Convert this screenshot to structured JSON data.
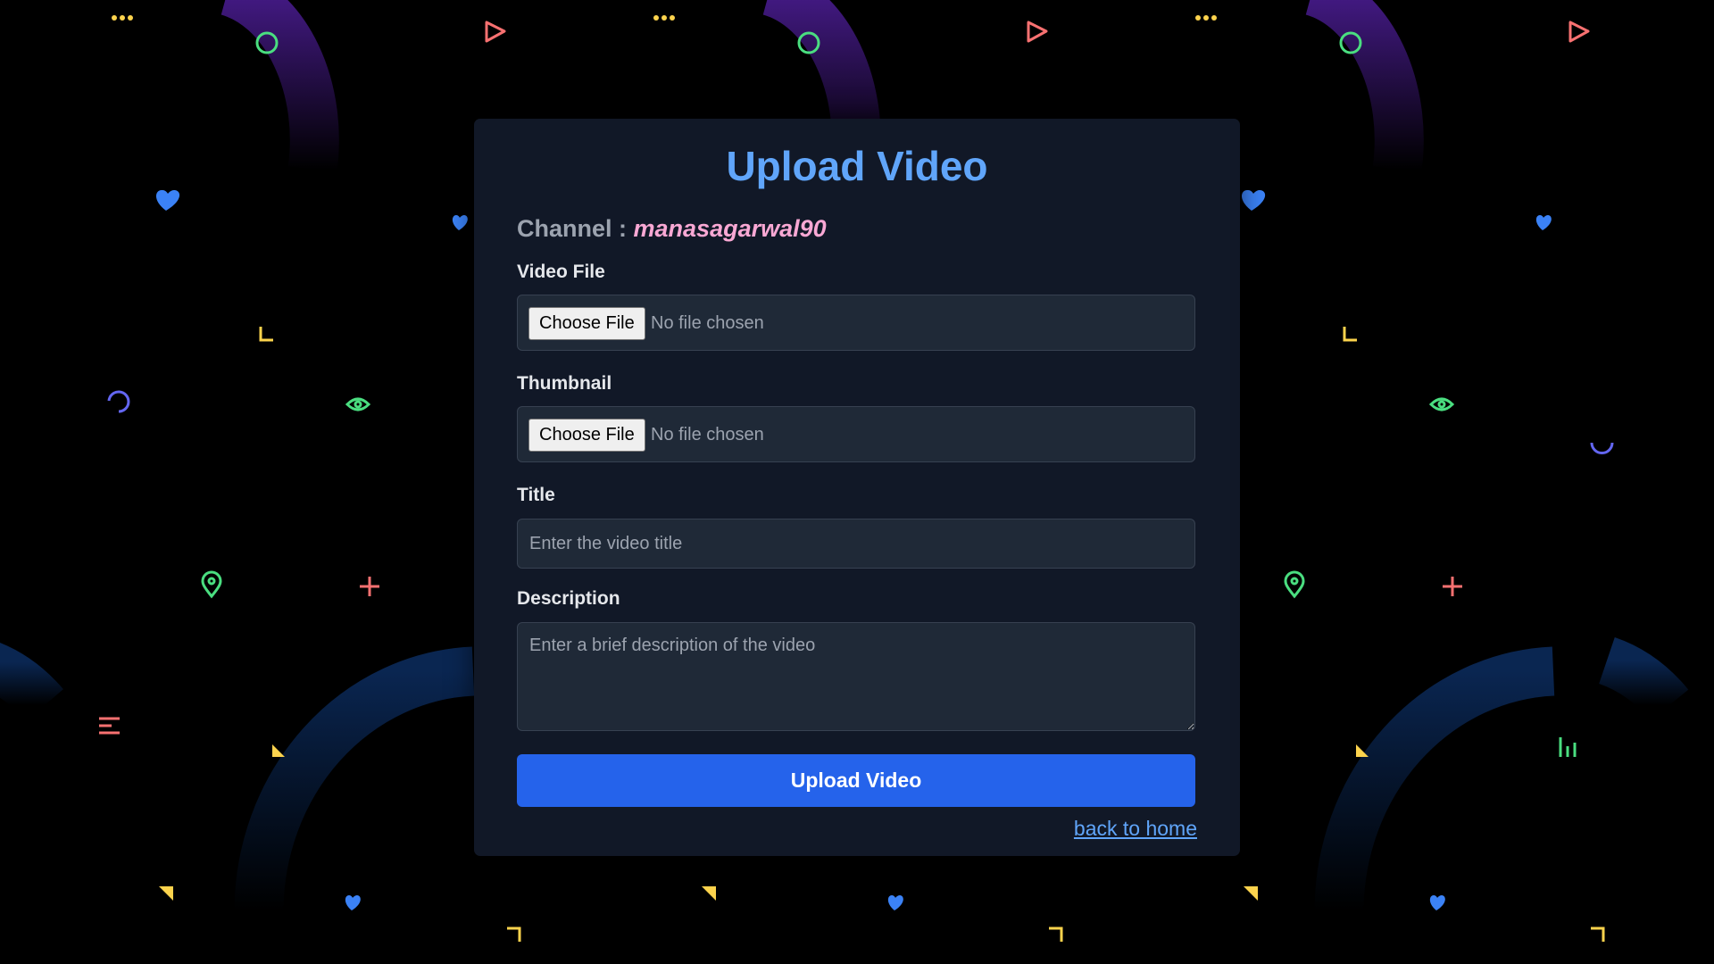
{
  "page": {
    "title": "Upload Video",
    "channel_label": "Channel : ",
    "channel_name": "manasagarwal90"
  },
  "form": {
    "video_file": {
      "label": "Video File",
      "button_label": "Choose File",
      "status": "No file chosen"
    },
    "thumbnail": {
      "label": "Thumbnail",
      "button_label": "Choose File",
      "status": "No file chosen"
    },
    "title": {
      "label": "Title",
      "placeholder": "Enter the video title",
      "value": ""
    },
    "description": {
      "label": "Description",
      "placeholder": "Enter a brief description of the video",
      "value": ""
    },
    "submit_label": "Upload Video",
    "back_link": "back to home"
  },
  "colors": {
    "background": "#000000",
    "card": "#111827",
    "accent": "#2563eb",
    "title": "#60a5fa",
    "channel_name": "#f9a8d4"
  },
  "background_icons": [
    "dots-icon",
    "circle-icon",
    "play-icon",
    "heart-icon",
    "corner-icon",
    "spinner-icon",
    "eye-icon",
    "map-pin-icon",
    "plus-icon",
    "menu-lines-icon",
    "triangle-icon",
    "bar-chart-icon"
  ]
}
